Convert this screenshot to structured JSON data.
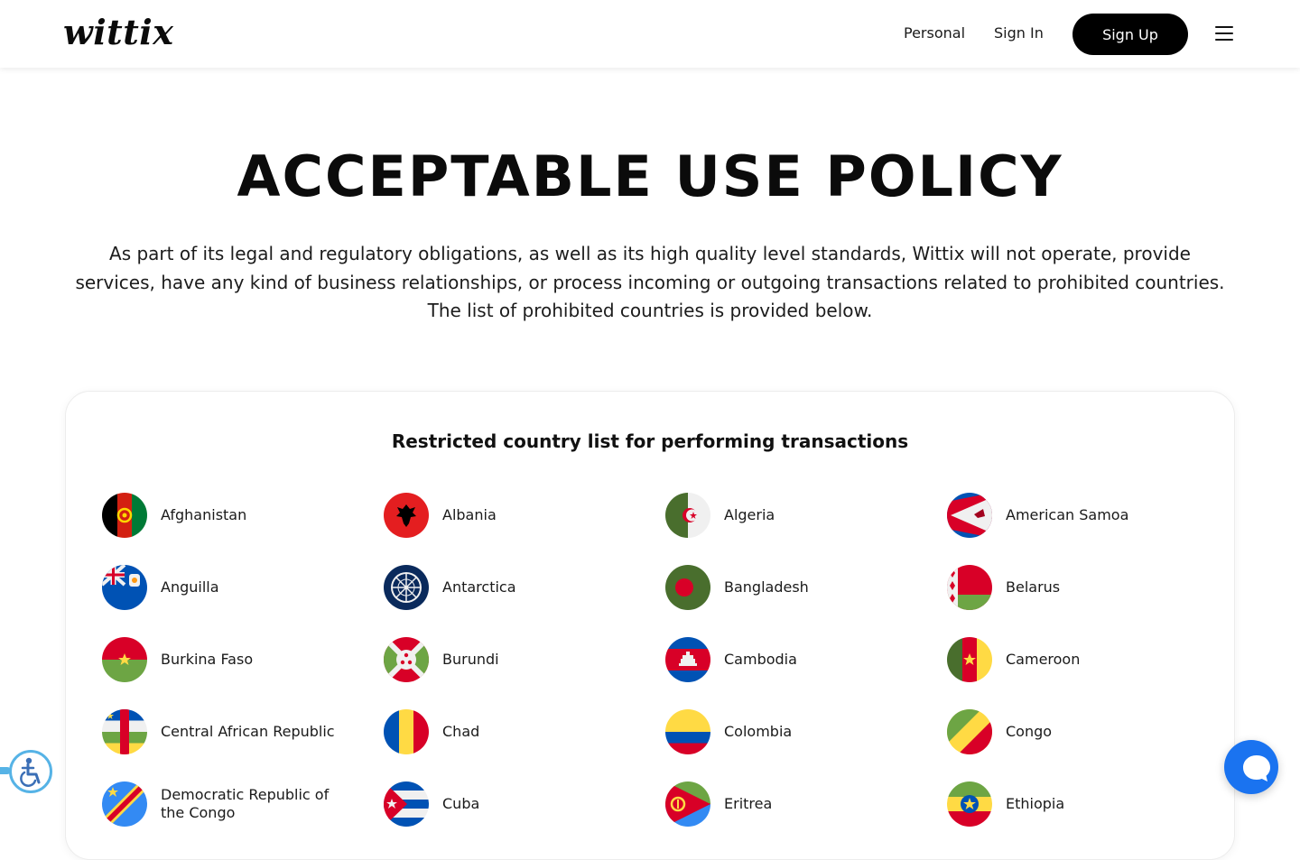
{
  "header": {
    "logo": "wittix",
    "nav_personal": "Personal",
    "nav_signin": "Sign In",
    "signup_label": "Sign Up"
  },
  "main": {
    "title": "ACCEPTABLE USE POLICY",
    "intro": "As part of its legal and regulatory obligations, as well as its high quality level standards, Wittix will not operate, provide services, have any kind of business relationships, or process incoming or outgoing transactions related to prohibited countries. The list of prohibited countries is provided below.",
    "card_title": "Restricted country list for performing transactions",
    "countries": [
      {
        "name": "Afghanistan",
        "icon": "afghanistan-flag-icon"
      },
      {
        "name": "Albania",
        "icon": "albania-flag-icon"
      },
      {
        "name": "Algeria",
        "icon": "algeria-flag-icon"
      },
      {
        "name": "American Samoa",
        "icon": "american-samoa-flag-icon"
      },
      {
        "name": "Anguilla",
        "icon": "anguilla-flag-icon"
      },
      {
        "name": "Antarctica",
        "icon": "antarctica-flag-icon"
      },
      {
        "name": "Bangladesh",
        "icon": "bangladesh-flag-icon"
      },
      {
        "name": "Belarus",
        "icon": "belarus-flag-icon"
      },
      {
        "name": "Burkina Faso",
        "icon": "burkina-faso-flag-icon"
      },
      {
        "name": "Burundi",
        "icon": "burundi-flag-icon"
      },
      {
        "name": "Cambodia",
        "icon": "cambodia-flag-icon"
      },
      {
        "name": "Cameroon",
        "icon": "cameroon-flag-icon"
      },
      {
        "name": "Central African Republic",
        "icon": "central-african-republic-flag-icon"
      },
      {
        "name": "Chad",
        "icon": "chad-flag-icon"
      },
      {
        "name": "Colombia",
        "icon": "colombia-flag-icon"
      },
      {
        "name": "Congo",
        "icon": "congo-flag-icon"
      },
      {
        "name": "Democratic Republic of the Congo",
        "icon": "dr-congo-flag-icon"
      },
      {
        "name": "Cuba",
        "icon": "cuba-flag-icon"
      },
      {
        "name": "Eritrea",
        "icon": "eritrea-flag-icon"
      },
      {
        "name": "Ethiopia",
        "icon": "ethiopia-flag-icon"
      }
    ]
  },
  "widgets": {
    "accessibility_icon": "accessibility-icon",
    "chat_icon": "chat-bubble-icon"
  },
  "colors": {
    "primary_button": "#000000",
    "chat_button": "#1a73f0",
    "accessibility_accent": "#56b3e6"
  }
}
